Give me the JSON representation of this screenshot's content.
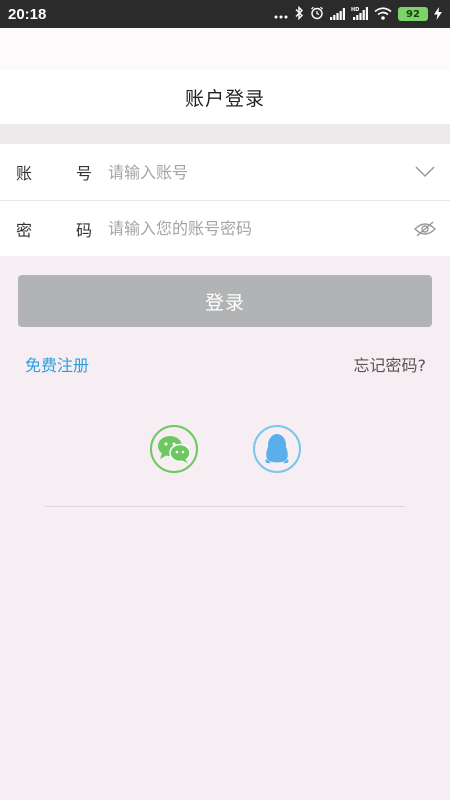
{
  "status_bar": {
    "time": "20:18",
    "battery": "92",
    "icons": [
      "dots-icon",
      "bluetooth-icon",
      "alarm-icon",
      "signal-icon",
      "hd-signal-icon",
      "wifi-icon",
      "battery-icon",
      "charging-icon"
    ]
  },
  "header": {
    "title": "账户登录"
  },
  "form": {
    "account": {
      "label_char1": "账",
      "label_char2": "号",
      "placeholder": "请输入账号",
      "icon": "chevron-down-icon"
    },
    "password": {
      "label_char1": "密",
      "label_char2": "码",
      "placeholder": "请输入您的账号密码",
      "icon": "eye-hidden-icon"
    }
  },
  "login_button": {
    "label": "登录"
  },
  "links": {
    "register": "免费注册",
    "forgot": "忘记密码?"
  },
  "social": {
    "items": [
      "wechat-icon",
      "qq-icon"
    ]
  },
  "colors": {
    "background": "#f6eef2",
    "button": "#b1b3b4",
    "register_link": "#2e9fdd",
    "wechat": "#6dc861",
    "qq": "#5aaee9"
  }
}
